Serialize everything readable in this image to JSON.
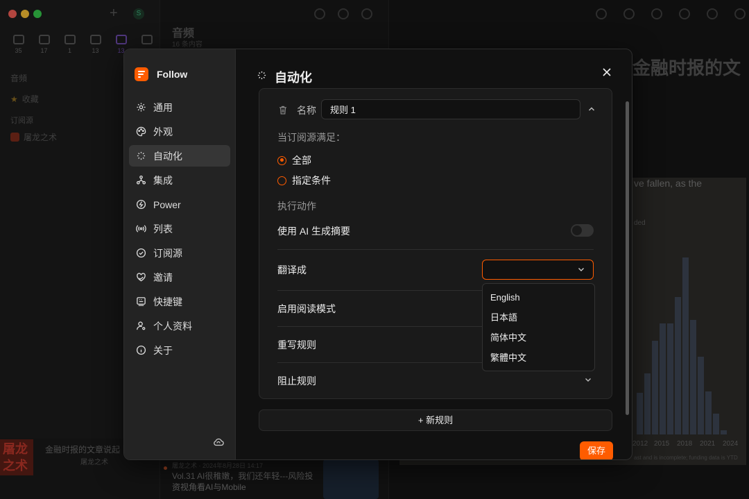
{
  "background": {
    "views": [
      {
        "icon": "article-icon",
        "count": "35"
      },
      {
        "icon": "twitter-icon",
        "count": "17"
      },
      {
        "icon": "picture-icon",
        "count": "1"
      },
      {
        "icon": "video-icon",
        "count": "13"
      },
      {
        "icon": "microphone-icon",
        "count": "13"
      },
      {
        "icon": "megaphone-icon",
        "count": ""
      }
    ],
    "section_label": "音頻",
    "favorites": "收藏",
    "subscriptions_label": "订阅源",
    "feed_name": "屠龙之术",
    "list_title": "音频",
    "list_subtitle": "16 条内容",
    "article_title": "金融时报的文",
    "chart_caption": "ve fallen, as the",
    "chart_small": "ded",
    "chart_years": [
      "2012",
      "2015",
      "2018",
      "2021",
      "2024"
    ],
    "chart_footer": "ast and is incomplete; funding data is YTD",
    "player_title": "金融时报的文章说起",
    "player_subtitle": "屠龙之术",
    "cover_text": "屠龙之术",
    "entry_meta": "屠龙之术 · 2024年8月28日 14:17",
    "entry_title": "Vol.31 AI很稚嫩，我们还年轻---风险投资视角看AI与Mobile"
  },
  "sidebar": {
    "app_name": "Follow",
    "items": [
      {
        "label": "通用",
        "icon": "gear-icon"
      },
      {
        "label": "外观",
        "icon": "palette-icon"
      },
      {
        "label": "自动化",
        "icon": "magic-wand-icon",
        "active": true
      },
      {
        "label": "集成",
        "icon": "integration-icon"
      },
      {
        "label": "Power",
        "icon": "power-icon"
      },
      {
        "label": "列表",
        "icon": "broadcast-icon"
      },
      {
        "label": "订阅源",
        "icon": "check-circle-icon"
      },
      {
        "label": "邀请",
        "icon": "heart-hands-icon"
      },
      {
        "label": "快捷键",
        "icon": "keyboard-icon"
      },
      {
        "label": "个人资料",
        "icon": "user-gear-icon"
      },
      {
        "label": "关于",
        "icon": "info-icon"
      }
    ]
  },
  "main": {
    "title": "自动化",
    "rule": {
      "name_label": "名称",
      "name_value": "规则 1",
      "condition_label": "当订阅源满足：",
      "condition_options": [
        {
          "label": "全部",
          "selected": true
        },
        {
          "label": "指定条件",
          "selected": false
        }
      ],
      "actions_label": "执行动作",
      "actions": {
        "summary": "使用 AI 生成摘要",
        "translate": "翻译成",
        "readability": "启用阅读模式",
        "rewrite": "重写规则",
        "block": "阻止规则"
      },
      "translate_value": "",
      "language_options": [
        "English",
        "日本語",
        "简体中文",
        "繁體中文"
      ]
    },
    "new_rule_label": "+ 新规则",
    "save_label": "保存"
  },
  "colors": {
    "accent": "#ff5c00"
  }
}
